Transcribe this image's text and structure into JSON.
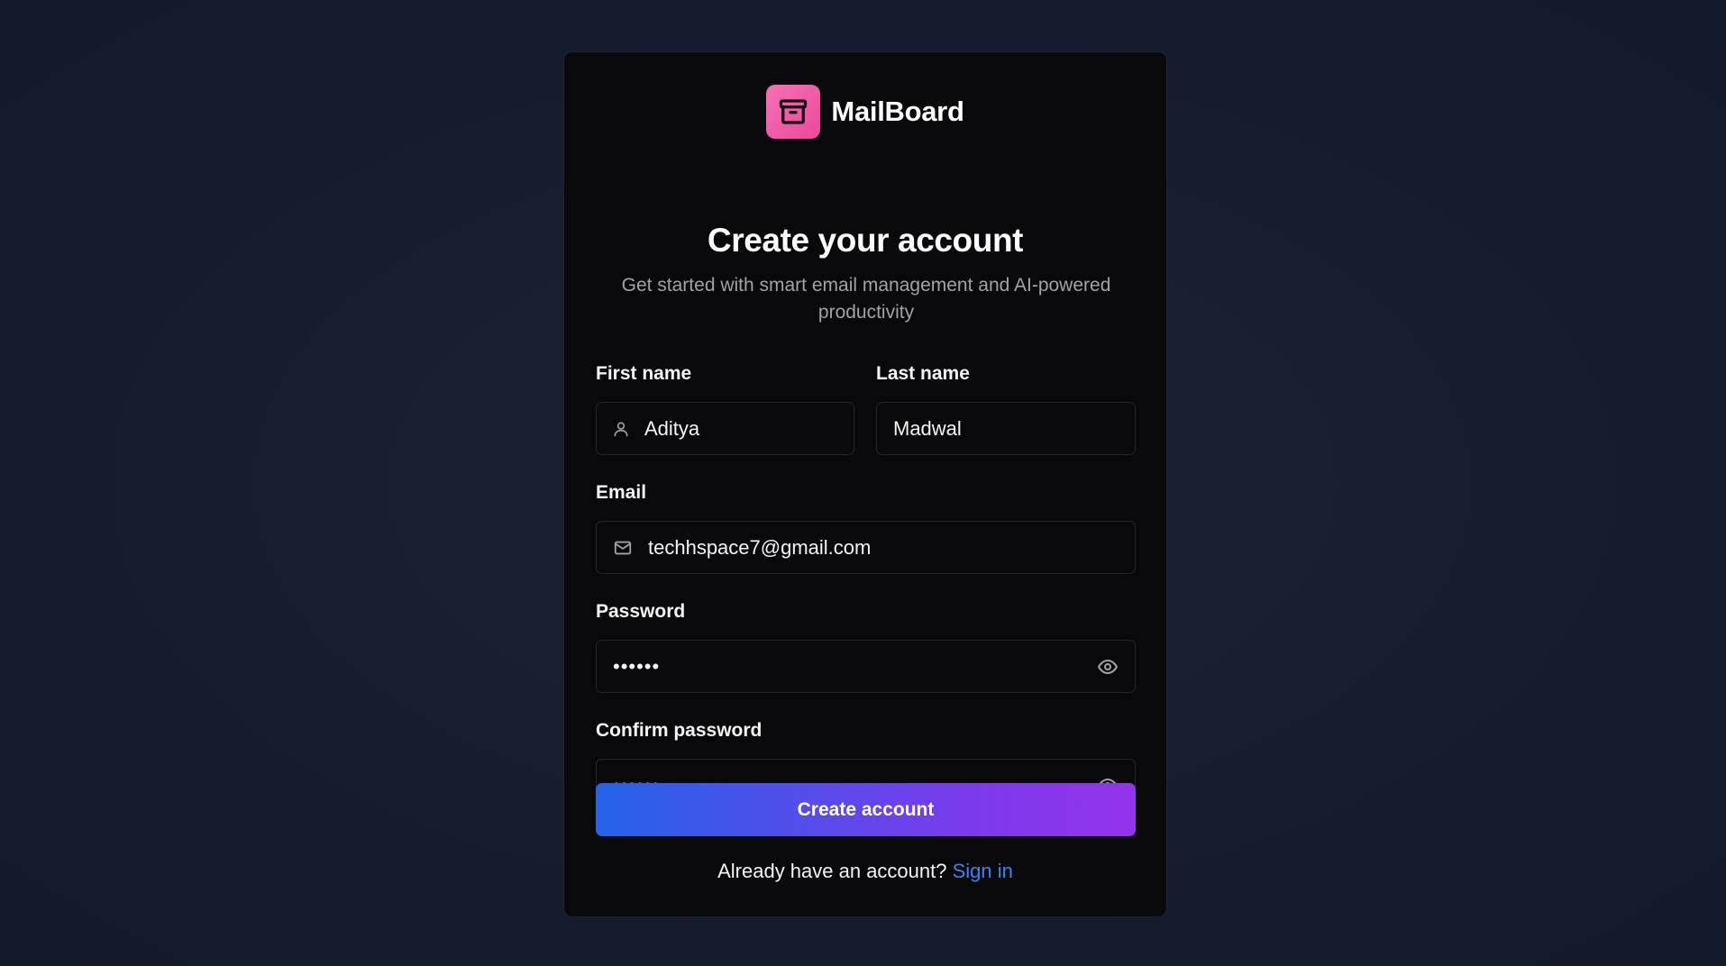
{
  "brand": {
    "name": "MailBoard",
    "logo_icon": "archive-box-icon",
    "logo_color": "#ec4899"
  },
  "heading": {
    "title": "Create your account",
    "subtitle": "Get started with smart email management and AI-powered productivity"
  },
  "form": {
    "first_name": {
      "label": "First name",
      "value": "Aditya",
      "icon": "user-icon"
    },
    "last_name": {
      "label": "Last name",
      "value": "Madwal"
    },
    "email": {
      "label": "Email",
      "value": "techhspace7@gmail.com",
      "icon": "mail-icon"
    },
    "password": {
      "label": "Password",
      "value": "••••••",
      "toggle_icon": "eye-icon"
    },
    "confirm_password": {
      "label": "Confirm password",
      "value": "••••••",
      "toggle_icon": "eye-icon"
    },
    "submit_label": "Create account"
  },
  "footer": {
    "prompt": "Already have an account?",
    "link_label": "Sign in",
    "link_color": "#3b82f6"
  },
  "colors": {
    "button_gradient_start": "#2563eb",
    "button_gradient_end": "#9333ea",
    "card_background": "#09090b"
  }
}
